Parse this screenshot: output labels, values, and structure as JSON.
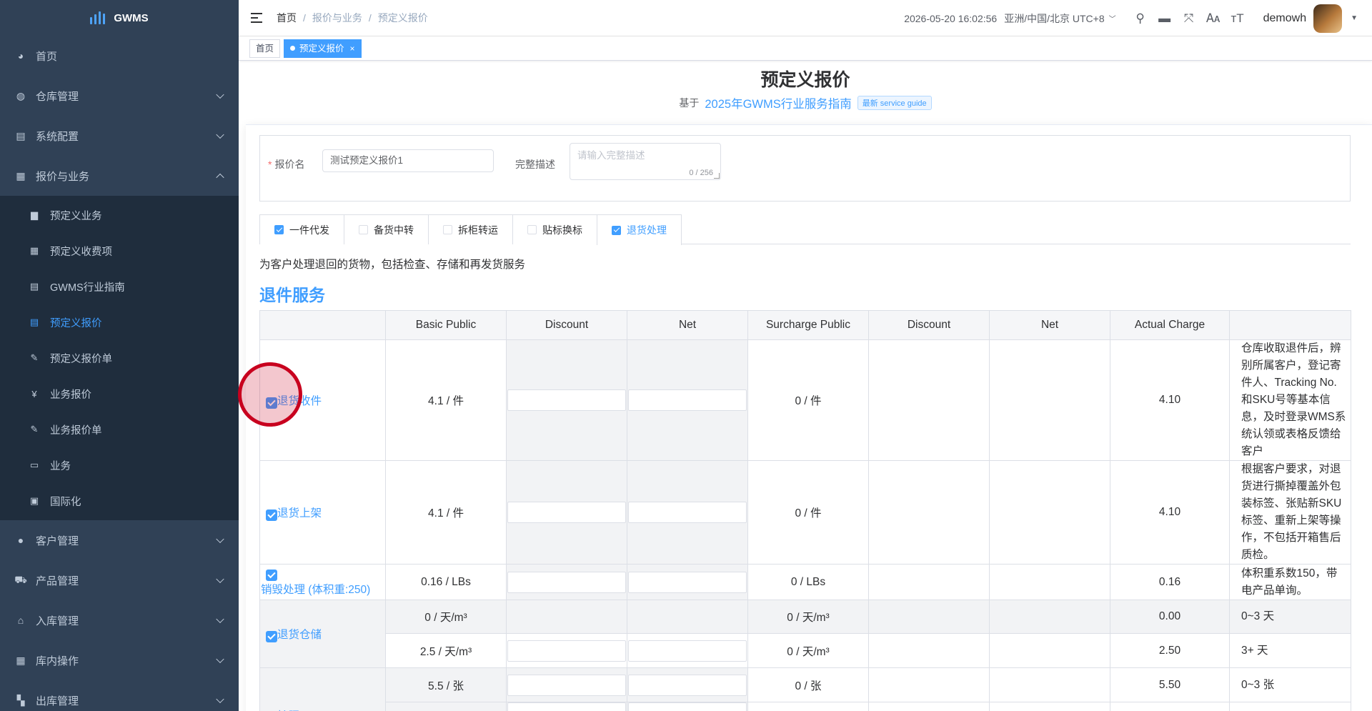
{
  "app": {
    "logo_text": "GWMS"
  },
  "sidebar": {
    "items": [
      {
        "label": "首页",
        "icon": "dashboard-icon"
      },
      {
        "label": "仓库管理",
        "icon": "globe-icon"
      },
      {
        "label": "系统配置",
        "icon": "config-icon"
      },
      {
        "label": "报价与业务",
        "icon": "quote-icon"
      }
    ],
    "subitems": [
      {
        "label": "预定义业务",
        "icon": "calendar-icon"
      },
      {
        "label": "预定义收费项",
        "icon": "table-icon"
      },
      {
        "label": "GWMS行业指南",
        "icon": "doc-icon"
      },
      {
        "label": "预定义报价",
        "icon": "doc-icon"
      },
      {
        "label": "预定义报价单",
        "icon": "edit-icon"
      },
      {
        "label": "业务报价",
        "icon": "yen-icon"
      },
      {
        "label": "业务报价单",
        "icon": "edit-icon"
      },
      {
        "label": "业务",
        "icon": "briefcase-icon"
      },
      {
        "label": "国际化",
        "icon": "image-icon"
      }
    ],
    "items_after": [
      {
        "label": "客户管理",
        "icon": "user-icon"
      },
      {
        "label": "产品管理",
        "icon": "cart-icon"
      },
      {
        "label": "入库管理",
        "icon": "home-icon"
      },
      {
        "label": "库内操作",
        "icon": "grid-icon"
      },
      {
        "label": "出库管理",
        "icon": "apps-icon"
      }
    ]
  },
  "header": {
    "breadcrumb": [
      "首页",
      "报价与业务",
      "预定义报价"
    ],
    "datetime": "2026-05-20 16:02:56",
    "timezone": "亚洲/中国/北京 UTC+8",
    "username": "demowh"
  },
  "tags": {
    "home": "首页",
    "current": "预定义报价"
  },
  "page": {
    "title": "预定义报价",
    "based_on": "基于",
    "guide_name": "2025年GWMS行业服务指南",
    "guide_badge": "最新 service guide"
  },
  "form": {
    "name_label": "报价名",
    "name_value": "测试预定义报价1",
    "desc_label": "完整描述",
    "desc_placeholder": "请输入完整描述",
    "desc_count": "0 / 256"
  },
  "service_tabs": [
    {
      "label": "一件代发",
      "checked": true
    },
    {
      "label": "备货中转",
      "checked": false
    },
    {
      "label": "拆柜转运",
      "checked": false
    },
    {
      "label": "贴标换标",
      "checked": false
    },
    {
      "label": "退货处理",
      "checked": true,
      "active": true
    }
  ],
  "service_description": "为客户处理退回的货物，包括检查、存储和再发货服务",
  "section_title": "退件服务",
  "table": {
    "headers": [
      "",
      "Basic Public",
      "Discount",
      "Net",
      "Surcharge Public",
      "Discount",
      "Net",
      "Actual Charge",
      ""
    ],
    "rows": [
      {
        "name": "退货收件",
        "basic": "4.1 / 件",
        "surcharge": "0 / 件",
        "actual": "4.10",
        "note": "仓库收取退件后，辨别所属客户，登记寄件人、Tracking No.和SKU号等基本信息，及时登录WMS系统认领或表格反馈给客户"
      },
      {
        "name": "退货上架",
        "basic": "4.1 / 件",
        "surcharge": "0 / 件",
        "actual": "4.10",
        "note": "根据客户要求，对退货进行撕掉覆盖外包装标签、张贴新SKU标签、重新上架等操作，不包括开箱售后质检。"
      },
      {
        "name": "销毁处理 (体积重:250)",
        "basic": "0.16 / LBs",
        "surcharge": "0 / LBs",
        "actual": "0.16",
        "note": "体积重系数150，带电产品单询。"
      },
      {
        "name": "退货仓储",
        "basic": "0 / 天/m³",
        "surcharge": "0 / 天/m³",
        "actual": "0.00",
        "note": "0~3 天",
        "basic2": "2.5 / 天/m³",
        "surcharge2": "0 / 天/m³",
        "actual2": "2.50",
        "note2": "3+ 天"
      },
      {
        "name": "拍照",
        "basic": "5.5 / 张",
        "surcharge": "0 / 张",
        "actual": "5.50",
        "note": "0~3 张"
      }
    ]
  },
  "colors": {
    "sidebar_bg": "#304156",
    "submenu_bg": "#1f2d3d",
    "accent": "#409eff",
    "pointer": "#c8001e"
  }
}
